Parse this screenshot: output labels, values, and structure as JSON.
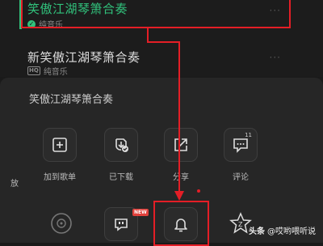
{
  "songs": [
    {
      "title": "笑傲江湖琴箫合奏",
      "subtitle": "纯音乐",
      "downloaded": true,
      "active": true
    },
    {
      "title": "新笑傲江湖琴箫合奏",
      "subtitle": "纯音乐",
      "quality": "HQ",
      "active": false
    }
  ],
  "more_glyph": "···",
  "sheet": {
    "title": "笑傲江湖琴箫合奏",
    "actions": [
      {
        "label": "放",
        "icon": "play-icon"
      },
      {
        "label": "加到歌单",
        "icon": "plus-square-icon"
      },
      {
        "label": "已下载",
        "icon": "downloaded-icon"
      },
      {
        "label": "分享",
        "icon": "share-icon"
      },
      {
        "label": "评论",
        "icon": "comment-icon",
        "badge": "11"
      }
    ],
    "row2": [
      {
        "icon": "disc-icon"
      },
      {
        "icon": "quote-icon",
        "badge": "NEW"
      },
      {
        "icon": "bell-icon"
      },
      {
        "icon": "star-z-icon"
      }
    ]
  },
  "watermark": {
    "brand": "头条",
    "text": "@哎哟喂听说"
  },
  "colors": {
    "accent": "#31c27c",
    "annotation": "#e41e26",
    "background": "#1a1a1a",
    "sheet": "#262626"
  }
}
